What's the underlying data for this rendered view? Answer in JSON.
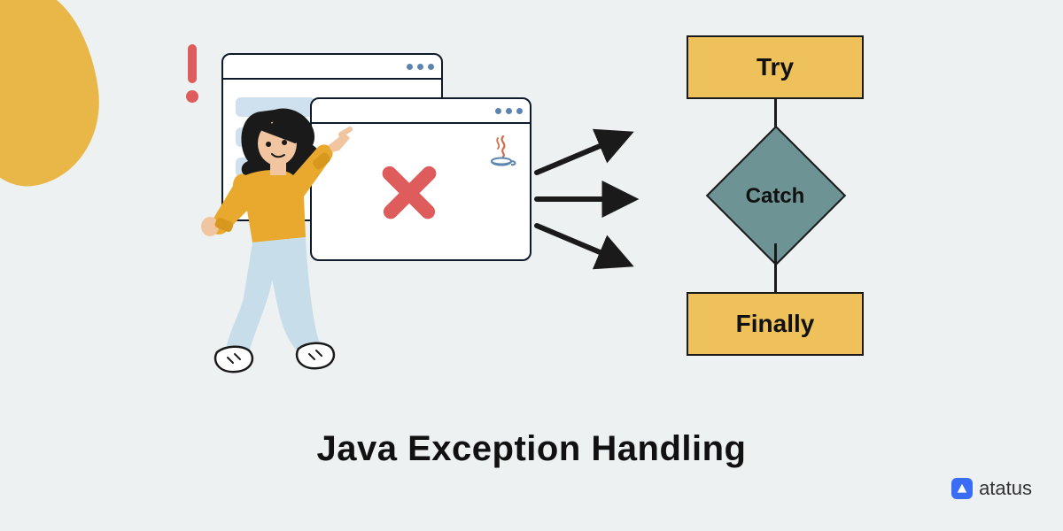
{
  "title": "Java Exception Handling",
  "flow": {
    "try": "Try",
    "catch": "Catch",
    "finally": "Finally"
  },
  "brand": {
    "name": "atatus"
  },
  "icons": {
    "exclamation": "exclamation-icon",
    "x": "x-icon",
    "java": "java-cup-icon",
    "arrows": "three-arrows-icon",
    "logo": "brand-logo-icon"
  },
  "colors": {
    "bg": "#edf1f1",
    "amber": "#eec15a",
    "teal": "#6d9394",
    "red": "#df5c5c",
    "dark": "#1a1a1a",
    "blue": "#3b6cf6"
  }
}
